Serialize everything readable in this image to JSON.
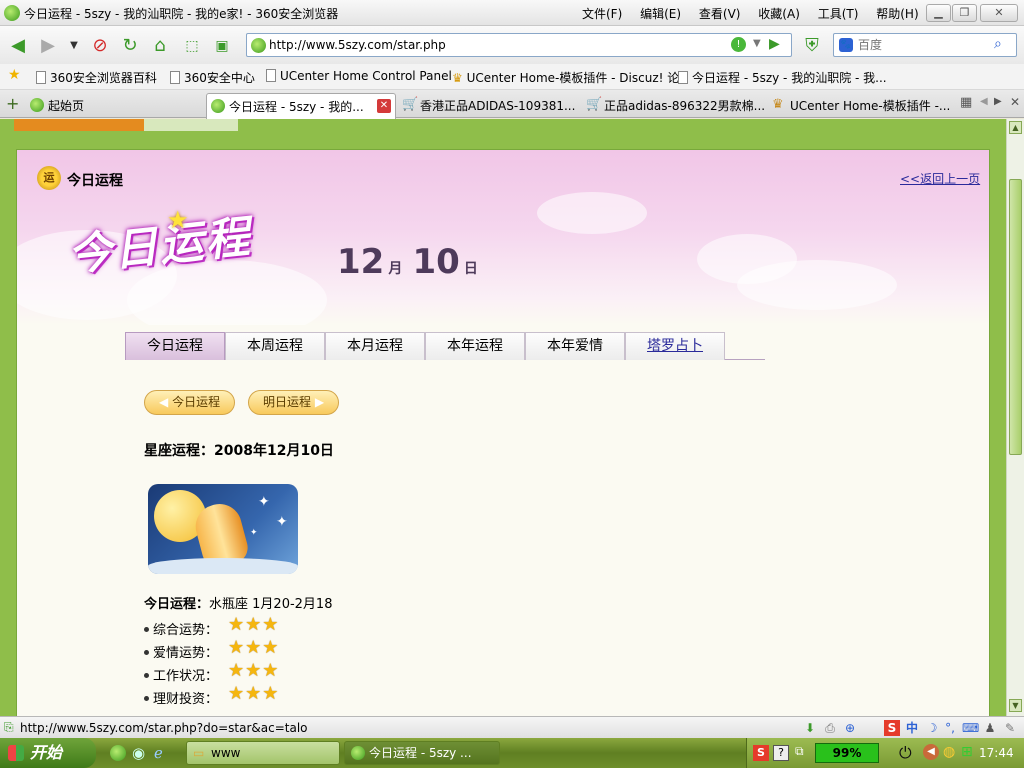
{
  "window": {
    "title": "今日运程 - 5szy - 我的汕职院 - 我的e家! - 360安全浏览器",
    "menu": [
      "文件(F)",
      "编辑(E)",
      "查看(V)",
      "收藏(A)",
      "工具(T)",
      "帮助(H)"
    ]
  },
  "nav": {
    "url": "http://www.5szy.com/star.php",
    "search_placeholder": "百度"
  },
  "favorites": [
    "360安全浏览器百科",
    "360安全中心",
    "UCenter Home Control Panel",
    "UCenter Home-模板插件 - Discuz! 论",
    "今日运程 - 5szy - 我的汕职院 - 我..."
  ],
  "tabs": [
    {
      "label": "起始页",
      "active": false
    },
    {
      "label": "今日运程 - 5szy - 我的...",
      "active": true
    },
    {
      "label": "香港正品ADIDAS-109381...",
      "active": false
    },
    {
      "label": "正品adidas-896322男款棉...",
      "active": false
    },
    {
      "label": "UCenter Home-模板插件 -...",
      "active": false
    }
  ],
  "page": {
    "panel_title": "今日运程",
    "sun_icon_char": "运",
    "back_link": "<<返回上一页",
    "logo_text": "今日运程",
    "date": {
      "month": "12",
      "month_unit": "月",
      "day": "10",
      "day_unit": "日"
    },
    "tabs": [
      "今日运程",
      "本周运程",
      "本月运程",
      "本年运程",
      "本年爱情",
      "塔罗占卜"
    ],
    "buttons": {
      "today": "今日运程",
      "tomorrow": "明日运程"
    },
    "star_title_label": "星座运程：",
    "star_title_value": "2008年12月10日",
    "today_label": "今日运程：",
    "today_value": "水瓶座 1月20-2月18",
    "ratings": [
      {
        "label": "综合运势：",
        "stars": 3
      },
      {
        "label": "爱情运势：",
        "stars": 3
      },
      {
        "label": "工作状况：",
        "stars": 3
      },
      {
        "label": "理财投资：",
        "stars": 3
      }
    ]
  },
  "status": {
    "url": "http://www.5szy.com/star.php?do=star&ac=talo"
  },
  "taskbar": {
    "start": "开始",
    "tasks": [
      "www",
      "今日运程 - 5szy ..."
    ],
    "battery": "99%",
    "clock": "17:44"
  },
  "colors": {
    "accent_green": "#8fbe4a",
    "banner_pink": "#f1c6e7",
    "star_gold": "#f5b60f"
  }
}
